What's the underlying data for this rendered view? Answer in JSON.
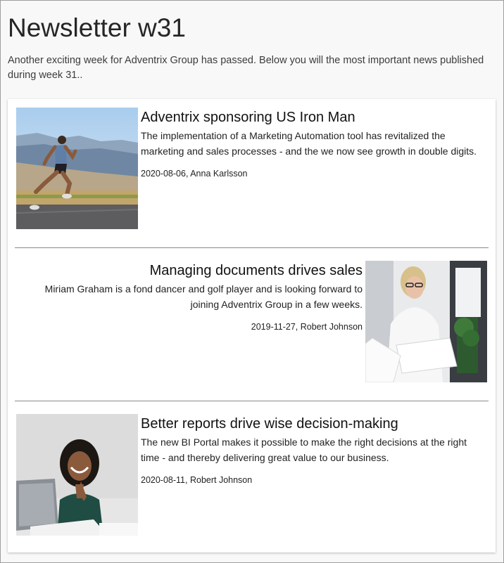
{
  "page": {
    "title": "Newsletter w31",
    "intro": "Another exciting week for Adventrix Group has passed. Below you will the most important news published during week 31.."
  },
  "articles": [
    {
      "headline": "Adventrix sponsoring US Iron Man",
      "summary": "The implementation of a Marketing Automation tool has revitalized the marketing and sales processes - and the we now see growth in double digits.",
      "meta": "2020-08-06, Anna Karlsson",
      "image": "runner-photo",
      "image_side": "left"
    },
    {
      "headline": "Managing documents drives sales",
      "summary": "Miriam Graham is a fond dancer and golf player and is looking forward to joining Adventrix Group in a few weeks.",
      "meta": "2019-11-27, Robert Johnson",
      "image": "woman-with-documents-photo",
      "image_side": "right"
    },
    {
      "headline": "Better reports drive wise decision-making",
      "summary": "The new BI Portal makes it possible to make the right decisions at the right time - and thereby delivering great value to our business.",
      "meta": "2020-08-11, Robert Johnson",
      "image": "smiling-woman-laptop-photo",
      "image_side": "left"
    }
  ]
}
